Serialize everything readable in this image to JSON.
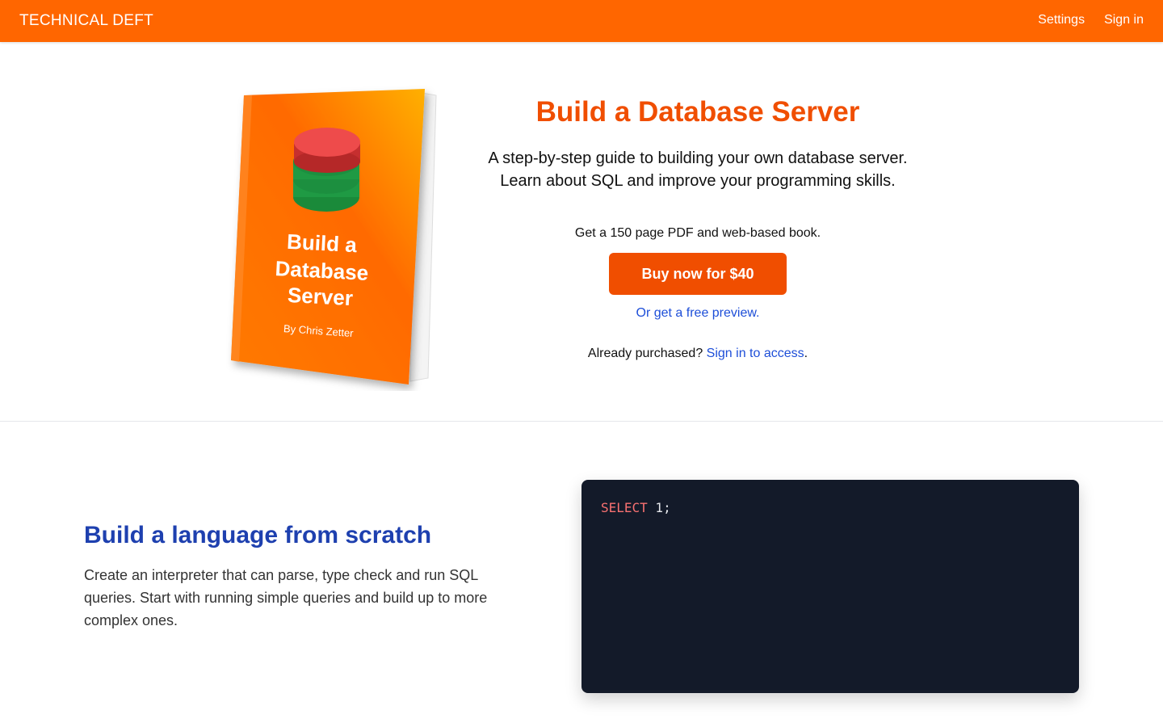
{
  "header": {
    "brand": "TECHNICAL DEFT",
    "nav": [
      {
        "label": "Settings"
      },
      {
        "label": "Sign in"
      }
    ],
    "background_color": "#ff6600"
  },
  "hero": {
    "book_cover": {
      "title_lines": [
        "Build a",
        "Database",
        "Server"
      ],
      "author": "By Chris Zetter",
      "icon": "database-icon"
    },
    "title": "Build a Database Server",
    "subtitle_lines": [
      "A step-by-step guide to building your own database server.",
      "Learn about SQL and improve your programming skills."
    ],
    "offer": "Get a 150 page PDF and web-based book.",
    "buy_label": "Buy now for $40",
    "preview_label": "Or get a free preview.",
    "already_purchased": "Already purchased?",
    "sign_in_link": "Sign in to access",
    "period": ".",
    "accent_color": "#f04e00",
    "link_color": "#1d4ed8"
  },
  "feature": {
    "title": "Build a language from scratch",
    "description": "Create an interpreter that can parse, type check and run SQL queries. Start with running simple queries and build up to more complex ones.",
    "title_color": "#1e40af",
    "code": {
      "keyword": "SELECT",
      "rest": " 1;",
      "background": "#131a29"
    }
  }
}
